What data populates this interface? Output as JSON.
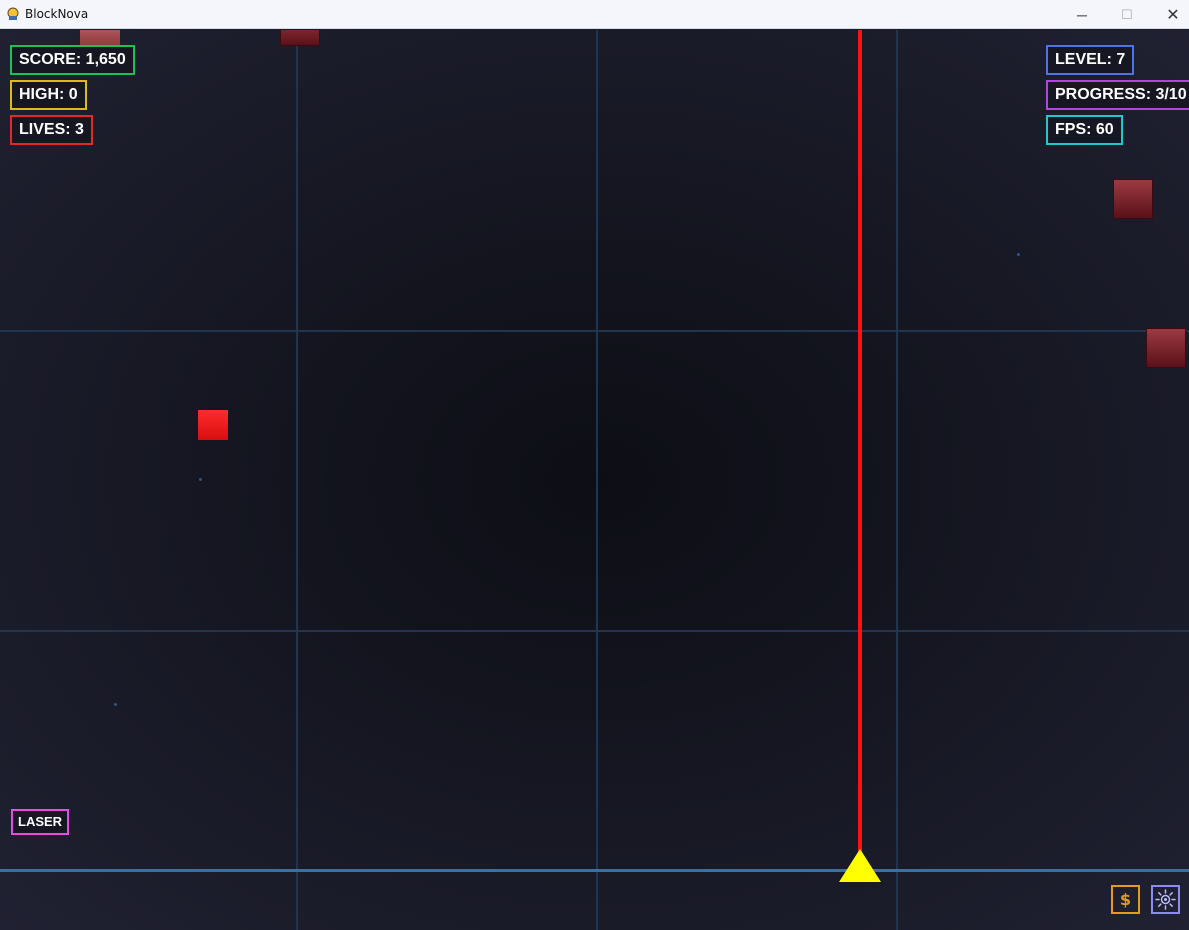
{
  "window": {
    "title": "BlockNova",
    "minimize_glyph": "─",
    "maximize_glyph": "☐",
    "close_glyph": "✕"
  },
  "hud": {
    "score": "SCORE: 1,650",
    "high": "HIGH: 0",
    "lives": "LIVES: 3",
    "level": "LEVEL: 7",
    "progress": "PROGRESS: 3/10",
    "fps": "FPS: 60"
  },
  "powerup": {
    "label": "LASER"
  },
  "buttons": {
    "shop_glyph": "$",
    "shop_icon": "dollar-icon",
    "settings_icon": "sun-gear-icon"
  },
  "colors": {
    "score_border": "#19c252",
    "high_border": "#e2b913",
    "lives_border": "#e02a2a",
    "level_border": "#4c73ea",
    "progress_border": "#b543e0",
    "fps_border": "#1fc7cf",
    "laser_border": "#e34de3",
    "laser_beam": "#ff1111",
    "ship": "#ffff00",
    "block_dark": "#7a2229",
    "block_bright": "#ff2020"
  }
}
